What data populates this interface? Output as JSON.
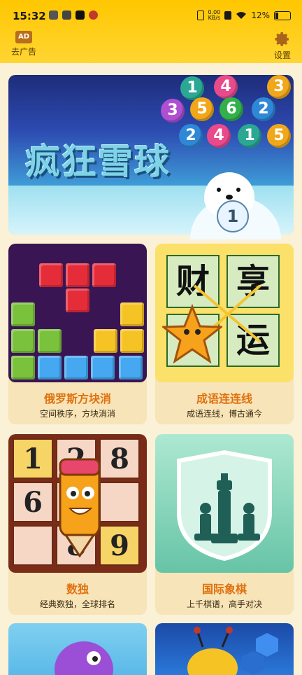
{
  "status_bar": {
    "time": "15:32",
    "net_speed_value": "0.00",
    "net_speed_unit": "KB/s",
    "battery": "12%"
  },
  "header": {
    "ad_badge": "AD",
    "remove_ads_label": "去广告",
    "settings_label": "设置"
  },
  "banner": {
    "title": "疯狂雪球",
    "bubbles": [
      "1",
      "4",
      "3",
      "5",
      "3",
      "5",
      "6",
      "2",
      "2",
      "4",
      "1",
      "5"
    ],
    "bear_ball": "1"
  },
  "games": [
    {
      "title": "俄罗斯方块消",
      "subtitle": "空间秩序，方块消消"
    },
    {
      "title": "成语连连线",
      "subtitle": "成语连线，博古通今",
      "art_chars": [
        "财",
        "享",
        "运"
      ]
    },
    {
      "title": "数独",
      "subtitle": "经典数独，全球排名",
      "art_digits": [
        "1",
        "2",
        "8",
        "6",
        "8",
        "9"
      ]
    },
    {
      "title": "国际象棋",
      "subtitle": "上千棋谱，高手对决"
    }
  ],
  "colors": {
    "header_yellow": "#ffc700",
    "background": "#fbf1d6",
    "card_bg": "#f7e4b8",
    "title_orange": "#e0700d"
  }
}
